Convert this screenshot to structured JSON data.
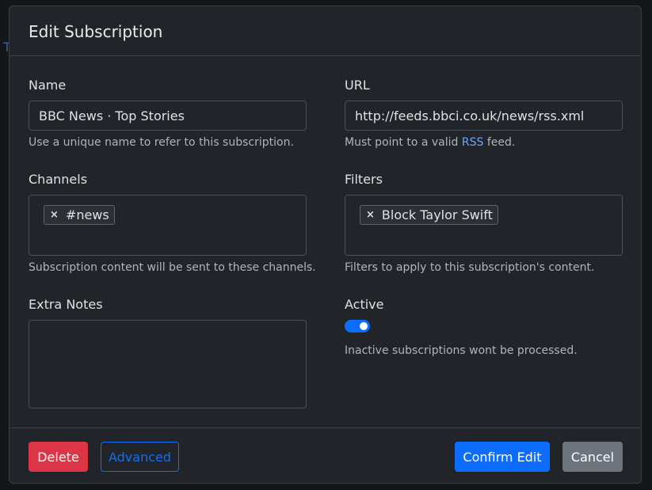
{
  "background": {
    "partial_text": "T"
  },
  "modal": {
    "title": "Edit Subscription",
    "name": {
      "label": "Name",
      "value": "BBC News · Top Stories",
      "help": "Use a unique name to refer to this subscription."
    },
    "url": {
      "label": "URL",
      "value": "http://feeds.bbci.co.uk/news/rss.xml",
      "help_before": "Must point to a valid ",
      "help_link": "RSS",
      "help_after": " feed."
    },
    "channels": {
      "label": "Channels",
      "tags": [
        "#news"
      ],
      "help": "Subscription content will be sent to these channels."
    },
    "filters": {
      "label": "Filters",
      "tags": [
        "Block Taylor Swift"
      ],
      "help": "Filters to apply to this subscription's content."
    },
    "extra_notes": {
      "label": "Extra Notes",
      "value": ""
    },
    "active": {
      "label": "Active",
      "checked": true,
      "help": "Inactive subscriptions wont be processed."
    },
    "footer": {
      "delete_label": "Delete",
      "advanced_label": "Advanced",
      "confirm_label": "Confirm Edit",
      "cancel_label": "Cancel"
    }
  },
  "colors": {
    "primary": "#0d6efd",
    "danger": "#dc3545",
    "secondary": "#6c757d",
    "surface": "#212529",
    "link": "#6ea8fe"
  },
  "icons": {
    "tag_remove": "close-icon"
  }
}
